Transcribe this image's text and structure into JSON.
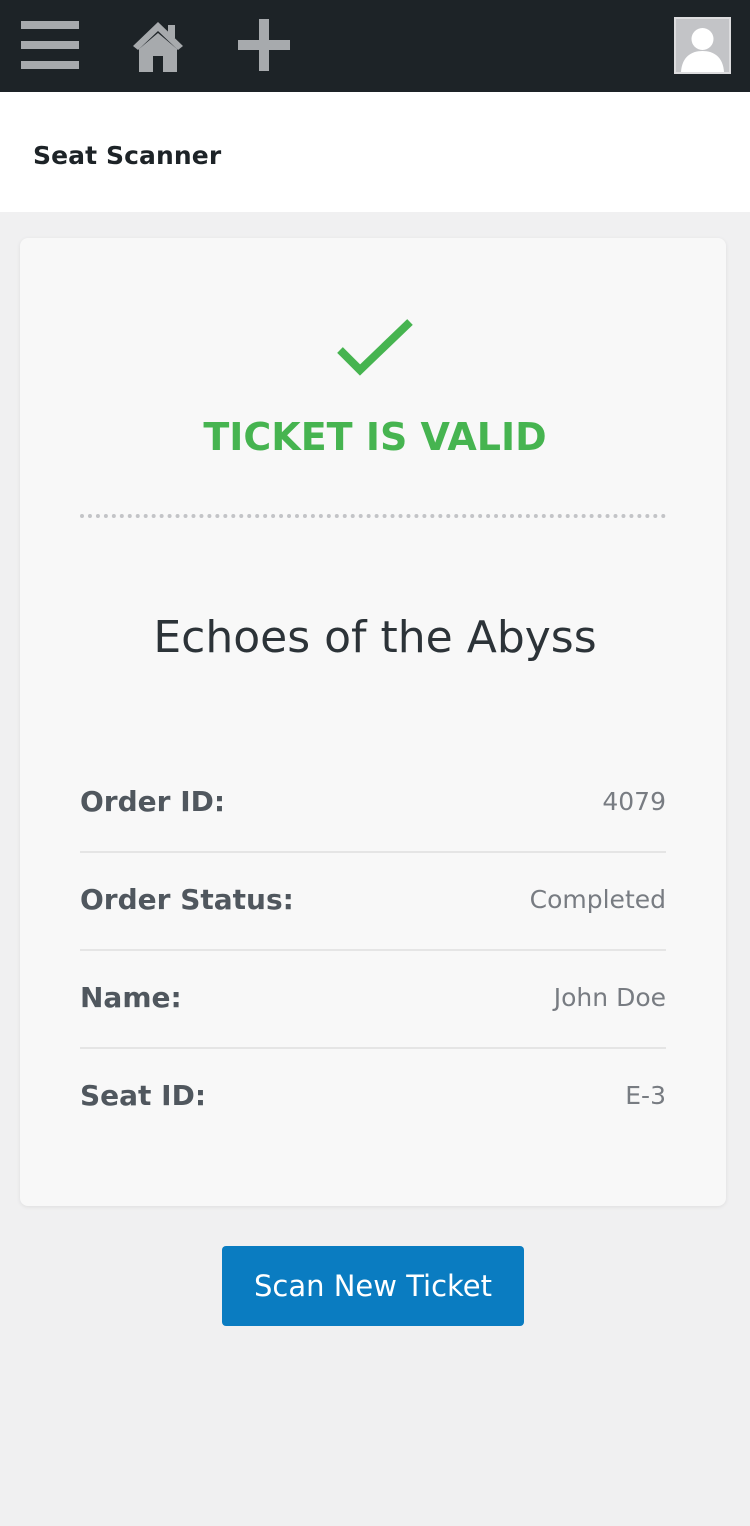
{
  "topbar": {
    "icons": {
      "menu": "menu-icon",
      "home": "home-icon",
      "add": "plus-icon",
      "avatar": "user-avatar"
    },
    "background_color": "#1d2327"
  },
  "page": {
    "title": "Seat Scanner"
  },
  "result": {
    "status": "TICKET IS VALID",
    "status_color": "#46b450",
    "icon": "checkmark-icon",
    "event_title": "Echoes of the Abyss",
    "details": [
      {
        "label": "Order ID:",
        "value": "4079"
      },
      {
        "label": "Order Status:",
        "value": "Completed"
      },
      {
        "label": "Name:",
        "value": "John Doe"
      },
      {
        "label": "Seat ID:",
        "value": "E-3"
      }
    ]
  },
  "actions": {
    "scan_new_label": "Scan New Ticket",
    "button_color": "#0a7cc1"
  }
}
